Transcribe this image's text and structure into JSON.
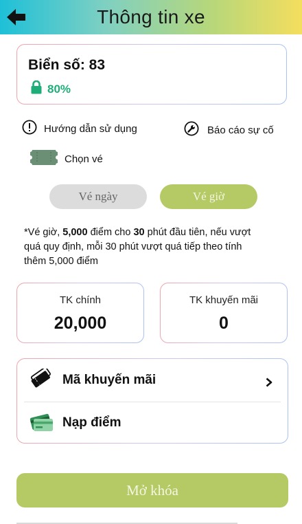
{
  "header": {
    "title": "Thông tin xe"
  },
  "vehicle": {
    "plate_label": "Biển số: 83",
    "battery_percent": "80%"
  },
  "actions": {
    "guide_label": "Hướng dẫn sử dụng",
    "report_label": "Báo cáo sự cố",
    "choose_ticket_label": "Chọn vé"
  },
  "ticket_types": {
    "day_label": "Vé ngày",
    "hour_label": "Vé giờ",
    "selected": "Vé giờ"
  },
  "note": {
    "prefix": "*Vé giờ, ",
    "points": "5,000",
    "middle": " điểm cho ",
    "minutes": "30",
    "suffix": " phút đầu tiên, nếu vượt quá quy định, mỗi 30 phút vượt quá tiếp theo tính thêm 5,000 điểm"
  },
  "accounts": {
    "main_label": "TK chính",
    "main_value": "20,000",
    "promo_label": "TK khuyến mãi",
    "promo_value": "0"
  },
  "menu": {
    "promo_code_label": "Mã khuyến mãi",
    "top_up_label": "Nạp điểm"
  },
  "unlock": {
    "label": "Mở khóa"
  },
  "colors": {
    "accent_green": "#b5c964",
    "battery_green": "#1fae7a",
    "header_gradient_start": "#1ec0d8",
    "header_gradient_end": "#f4de5e"
  }
}
